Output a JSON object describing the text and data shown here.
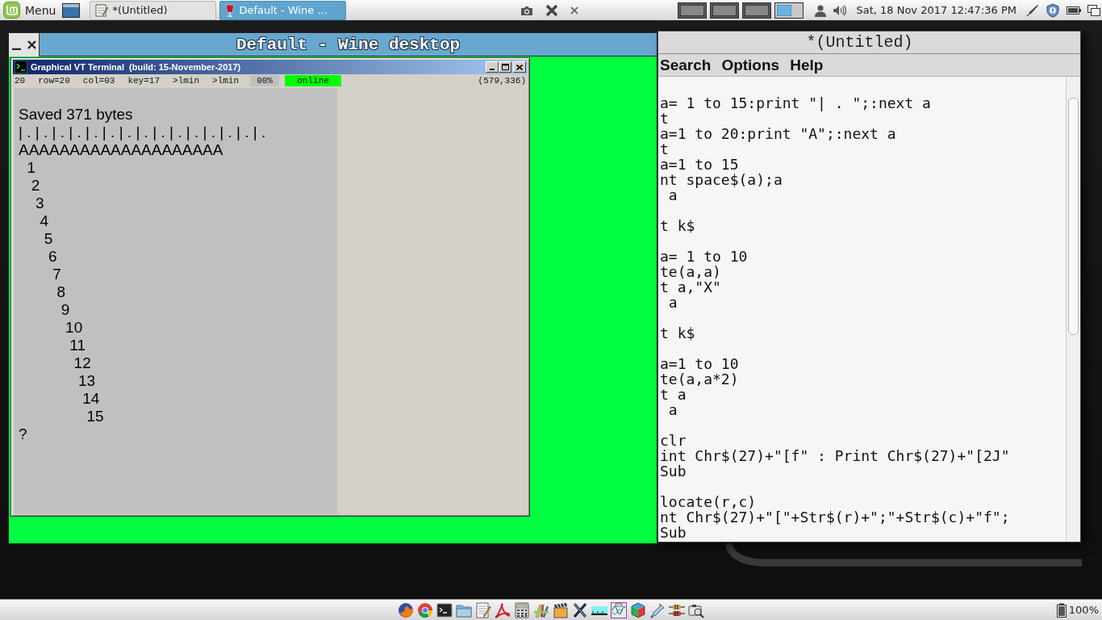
{
  "top_panel": {
    "menu": {
      "label": "Menu"
    },
    "taskbar_buttons": [
      {
        "kind": "editor",
        "label": "*(Untitled)",
        "selected": false
      },
      {
        "kind": "wine",
        "label": "Default - Wine ...",
        "selected": true
      }
    ],
    "workspaces": [
      {
        "selected": false
      },
      {
        "selected": false
      },
      {
        "selected": false
      },
      {
        "selected": true
      }
    ],
    "clock": "Sat, 18 Nov 2017 12:47:36 PM"
  },
  "wine_window": {
    "title": "Default - Wine desktop",
    "terminal": {
      "title": "Graphical VT Terminal  (build: 15-November-2017)",
      "status": [
        {
          "kind": "plain",
          "text": "20"
        },
        {
          "kind": "plain",
          "text": "row=20"
        },
        {
          "kind": "plain",
          "text": "col=03"
        },
        {
          "kind": "plain",
          "text": "key=17"
        },
        {
          "kind": "plain",
          "text": ">lmin"
        },
        {
          "kind": "plain",
          "text": ">lmin"
        },
        {
          "kind": "meter",
          "text": "00%"
        },
        {
          "kind": "indicator",
          "text": "online"
        },
        {
          "kind": "coords",
          "text": "(579,336)"
        }
      ],
      "lines": [
        "Saved 371 bytes",
        "| . | . | . | . | . | . | . | . | . | . | . | . | . | . | .",
        "AAAAAAAAAAAAAAAAAAAA",
        "  1",
        "   2",
        "    3",
        "     4",
        "      5",
        "       6",
        "        7",
        "         8",
        "          9",
        "           10",
        "            11",
        "             12",
        "              13",
        "               14",
        "                15",
        "?"
      ]
    }
  },
  "editor": {
    "title": "*(Untitled)",
    "menu": [
      "Search",
      "Options",
      "Help"
    ],
    "code_blocks": [
      [
        "a= 1 to 15:print \"| . \";:next a",
        "t",
        "a=1 to 20:print \"A\";:next a",
        "t",
        "a=1 to 15",
        "nt space$(a);a",
        " a"
      ],
      [
        "t k$"
      ],
      [
        "a= 1 to 10",
        "te(a,a)",
        "t a,\"X\"",
        " a"
      ],
      [
        "t k$"
      ],
      [
        "a=1 to 10",
        "te(a,a*2)",
        "t a",
        " a"
      ],
      [
        "clr",
        "int Chr$(27)+\"[f\" : Print Chr$(27)+\"[2J\"",
        "Sub"
      ],
      [
        "locate(r,c)",
        "nt Chr$(27)+\"[\"+Str$(r)+\";\"+Str$(c)+\"f\";",
        "Sub"
      ]
    ]
  },
  "bottom_panel": {
    "battery": "100%"
  }
}
